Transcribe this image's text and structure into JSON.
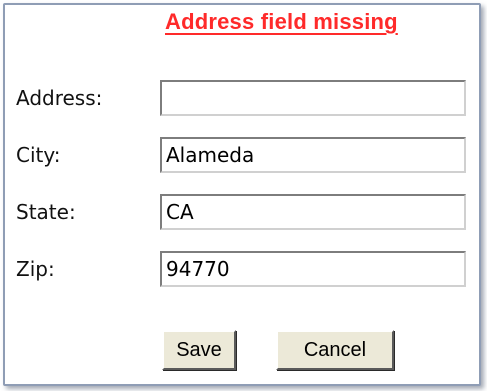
{
  "form": {
    "error_message": "Address field missing",
    "fields": [
      {
        "label": "Address:",
        "value": ""
      },
      {
        "label": "City:",
        "value": "Alameda"
      },
      {
        "label": "State:",
        "value": "CA"
      },
      {
        "label": "Zip:",
        "value": "94770"
      }
    ],
    "buttons": {
      "save_label": "Save",
      "cancel_label": "Cancel"
    }
  },
  "colors": {
    "error": "#ff2a2a",
    "border": "#8f9db5",
    "button_face": "#ece9d8"
  }
}
